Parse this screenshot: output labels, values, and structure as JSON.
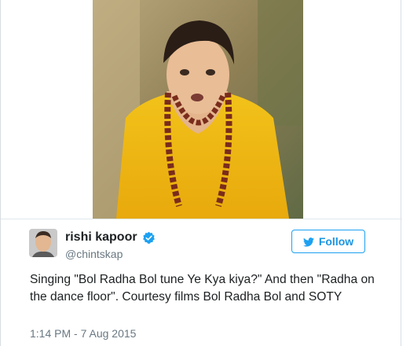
{
  "tweet": {
    "display_name": "rishi kapoor",
    "handle": "@chintskap",
    "follow_label": "Follow",
    "text": "Singing \"Bol Radha Bol tune Ye Kya kiya?\" And then \"Radha on the dance floor\". Courtesy films Bol Radha Bol and SOTY",
    "timestamp": "1:14 PM - 7 Aug 2015",
    "verified": true
  },
  "icons": {
    "verified": "verified-badge-icon",
    "follow": "twitter-bird-icon"
  },
  "colors": {
    "accent": "#1da1f2",
    "verified": "#1da1f2",
    "text": "#1c2022",
    "muted": "#697882"
  }
}
